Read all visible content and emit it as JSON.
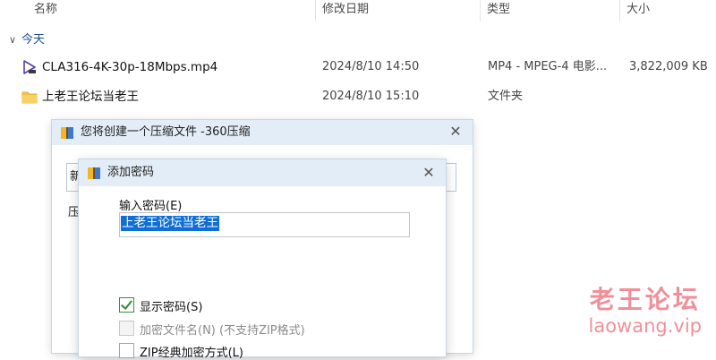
{
  "explorer": {
    "columns": {
      "name": "名称",
      "modified": "修改日期",
      "type": "类型",
      "size": "大小"
    },
    "group_label": "今天",
    "files": [
      {
        "name": "CLA316-4K-30p-18Mbps.mp4",
        "modified": "2024/8/10 14:50",
        "type": "MP4 - MPEG-4 电影...",
        "size": "3,822,009 KB",
        "icon": "video-file-icon"
      },
      {
        "name": "上老王论坛当老王",
        "modified": "2024/8/10 15:10",
        "type": "文件夹",
        "size": "",
        "icon": "folder-icon"
      }
    ]
  },
  "compress_dialog": {
    "title": "您将创建一个压缩文件 -360压缩",
    "field_peek": "新",
    "label_peek": "压"
  },
  "password_dialog": {
    "title": "添加密码",
    "input_label": "输入密码(E)",
    "password_value": "上老王论坛当老王",
    "options": [
      {
        "label": "显示密码(S)",
        "checked": true,
        "enabled": true
      },
      {
        "label": "加密文件名(N) (不支持ZIP格式)",
        "checked": false,
        "enabled": false
      },
      {
        "label": "ZIP经典加密方式(L)",
        "checked": false,
        "enabled": true
      }
    ]
  },
  "watermark": {
    "line1": "老王论坛",
    "line2": "laowang.vip"
  },
  "colors": {
    "accent": "#0f6fd6",
    "title_bar": "#e2edf7",
    "watermark": "#e63545"
  }
}
